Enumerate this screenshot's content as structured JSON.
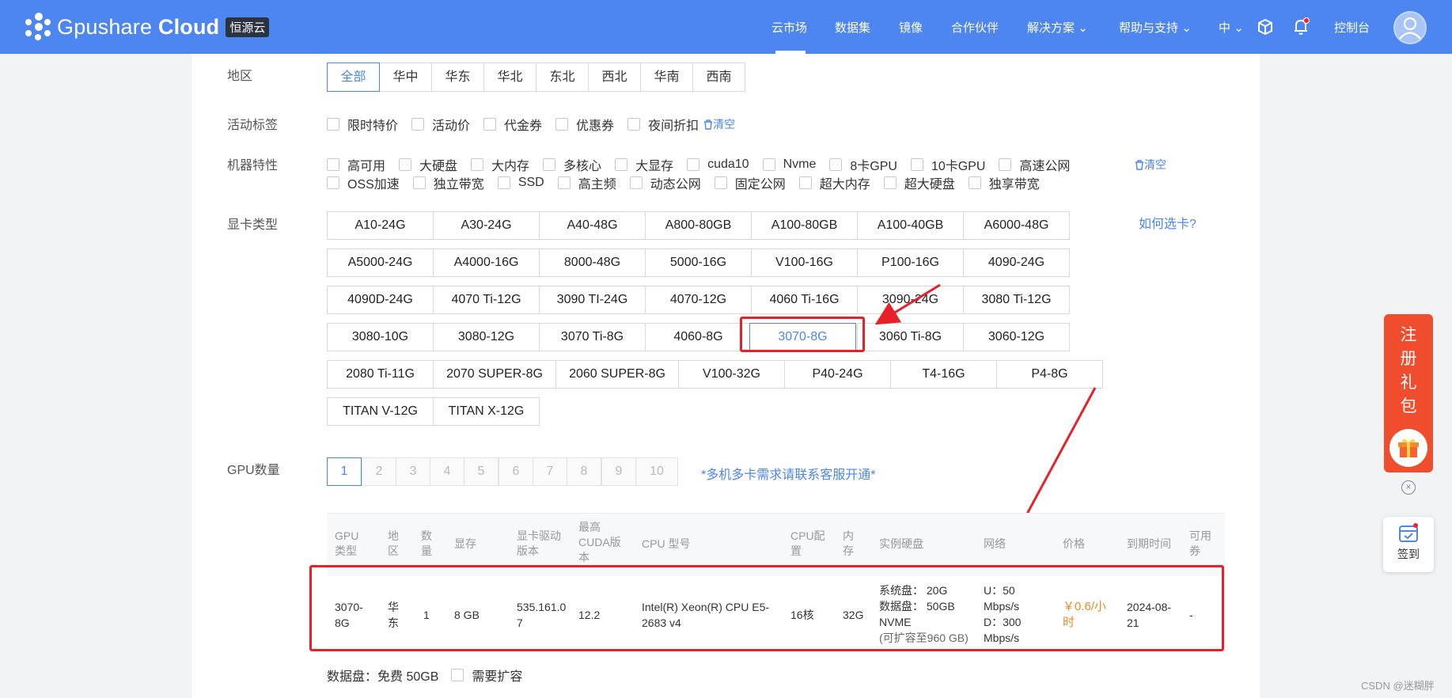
{
  "header": {
    "logo_text": "Gpushare",
    "logo_bold": "Cloud",
    "logo_badge": "恒源云",
    "nav": [
      "云市场",
      "数据集",
      "镜像",
      "合作伙伴",
      "解决方案",
      "帮助与支持",
      "中",
      "控制台"
    ],
    "active_nav": "云市场"
  },
  "filters": {
    "region_label": "地区",
    "regions": [
      "全部",
      "华中",
      "华东",
      "华北",
      "东北",
      "西北",
      "华南",
      "西南"
    ],
    "region_active": "全部",
    "activity_label": "活动标签",
    "activities": [
      "限时特价",
      "活动价",
      "代金券",
      "优惠券",
      "夜间折扣"
    ],
    "clear": "清空",
    "machine_label": "机器特性",
    "machine_row1": [
      "高可用",
      "大硬盘",
      "大内存",
      "多核心",
      "大显存",
      "cuda10",
      "Nvme",
      "8卡GPU",
      "10卡GPU",
      "高速公网"
    ],
    "machine_row2": [
      "OSS加速",
      "独立带宽",
      "SSD",
      "高主频",
      "动态公网",
      "固定公网",
      "超大内存",
      "超大硬盘",
      "独享带宽"
    ],
    "gpu_label": "显卡类型",
    "how_to_choose": "如何选卡?",
    "gpu_rows": [
      [
        "A10-24G",
        "A30-24G",
        "A40-48G",
        "A800-80GB",
        "A100-80GB",
        "A100-40GB",
        "A6000-48G"
      ],
      [
        "A5000-24G",
        "A4000-16G",
        "8000-48G",
        "5000-16G",
        "V100-16G",
        "P100-16G",
        "4090-24G"
      ],
      [
        "4090D-24G",
        "4070 Ti-12G",
        "3090 TI-24G",
        "4070-12G",
        "4060 Ti-16G",
        "3090-24G",
        "3080 Ti-12G"
      ],
      [
        "3080-10G",
        "3080-12G",
        "3070 Ti-8G",
        "4060-8G",
        "3070-8G",
        "3060 Ti-8G",
        "3060-12G"
      ],
      [
        "2080 Ti-11G",
        "2070 SUPER-8G",
        "2060 SUPER-8G",
        "V100-32G",
        "P40-24G",
        "T4-16G",
        "P4-8G"
      ],
      [
        "TITAN V-12G",
        "TITAN X-12G"
      ]
    ],
    "gpu_active": "3070-8G",
    "count_label": "GPU数量",
    "counts": [
      "1",
      "2",
      "3",
      "4",
      "5",
      "6",
      "7",
      "8",
      "9",
      "10"
    ],
    "count_active": "1",
    "multi_note": "*多机多卡需求请联系客服开通*"
  },
  "table": {
    "headers": [
      "GPU类型",
      "地区",
      "数量",
      "显存",
      "显卡驱动版本",
      "最高CUDA版本",
      "CPU 型号",
      "CPU配置",
      "内存",
      "实例硬盘",
      "网络",
      "价格",
      "到期时间",
      "可用券"
    ],
    "row": {
      "gpu": "3070-8G",
      "region": "华东",
      "count": "1",
      "vram": "8 GB",
      "driver": "535.161.07",
      "cuda": "12.2",
      "cpu_model": "Intel(R) Xeon(R) CPU E5-2683 v4",
      "cpu_cfg": "16核",
      "mem": "32G",
      "disk_sys": "系统盘：  20G",
      "disk_data": "数据盘：  50GB",
      "disk_type": "NVME",
      "disk_note": "(可扩容至960 GB)",
      "net_up": "U：50 Mbps/s",
      "net_down": "D：300 Mbps/s",
      "price": "￥0.6/小时",
      "expire": "2024-08-21",
      "coupon": "-"
    }
  },
  "footer": {
    "data_disk": "数据盘：免费 50GB",
    "expand": "需要扩容"
  },
  "side": {
    "promo": [
      "注",
      "册",
      "礼",
      "包"
    ],
    "signin": "签到",
    "close": "×"
  },
  "watermark": "CSDN @迷糊胖"
}
